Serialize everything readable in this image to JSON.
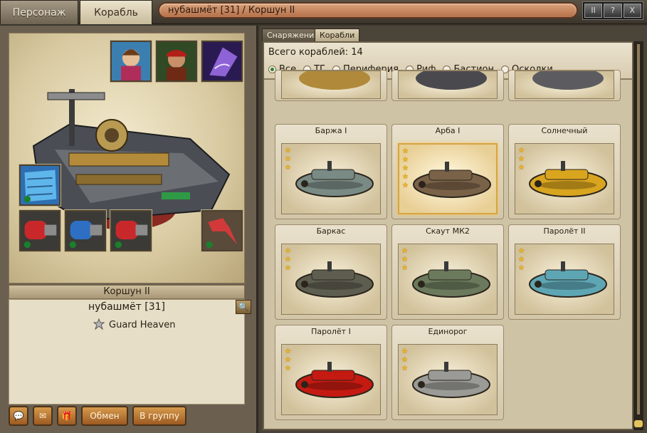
{
  "tabs": {
    "character": "Персонаж",
    "ship": "Корабль"
  },
  "window_title": "нубашмёт [31] / Коршун II",
  "window_controls": [
    "II",
    "?",
    "X"
  ],
  "left_panel": {
    "ship_name": "Коршун II",
    "owner": "нубашмёт [31]",
    "guild": "Guard Heaven",
    "buttons": {
      "trade": "Обмен",
      "invite_group": "В группу"
    },
    "equipment": [
      "crew-woman-portrait",
      "crew-pirate-portrait",
      "purple-flag",
      "blue-armor-module",
      "red-cannon",
      "blue-cannon",
      "red-cannon",
      "red-grapple"
    ]
  },
  "right_panel": {
    "subtabs": [
      "Снаряжение",
      "Корабли"
    ],
    "total_label": "Всего кораблей: 14",
    "filters": [
      {
        "label": "Все",
        "checked": true
      },
      {
        "label": "ТГ",
        "checked": false
      },
      {
        "label": "Периферия",
        "checked": false
      },
      {
        "label": "Риф",
        "checked": false
      },
      {
        "label": "Бастион",
        "checked": false
      },
      {
        "label": "Осколки",
        "checked": false
      }
    ],
    "ships": [
      {
        "name": "Баржа I",
        "stars": 3,
        "color": "#7a8a84"
      },
      {
        "name": "Арба I",
        "stars": 5,
        "color": "#7a6248",
        "selected": true
      },
      {
        "name": "Солнечный",
        "stars": 3,
        "color": "#d9a51f"
      },
      {
        "name": "Баркас",
        "stars": 3,
        "color": "#5e5e50"
      },
      {
        "name": "Скаут МК2",
        "stars": 3,
        "color": "#6b7a5c"
      },
      {
        "name": "Паролёт II",
        "stars": 3,
        "color": "#5ea6b4"
      },
      {
        "name": "Паролёт I",
        "stars": 3,
        "color": "#c41a12"
      },
      {
        "name": "Единорог",
        "stars": 3,
        "color": "#9a9a96"
      }
    ]
  }
}
